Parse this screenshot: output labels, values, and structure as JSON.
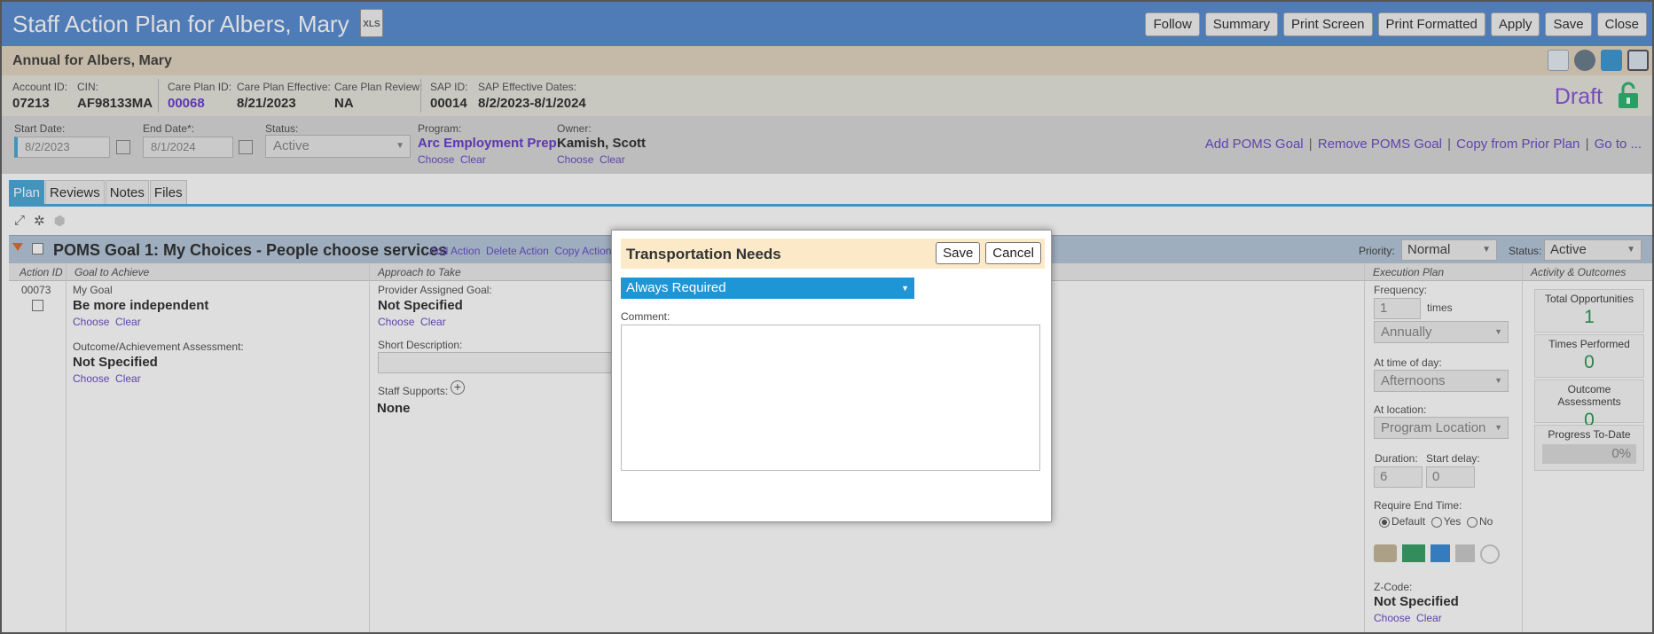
{
  "window": {
    "title": "Staff Action Plan for Albers, Mary",
    "xls_label": "XLS",
    "buttons": [
      "Follow",
      "Summary",
      "Print Screen",
      "Print Formatted",
      "Apply",
      "Save",
      "Close"
    ]
  },
  "annual": {
    "label": "Annual for Albers, Mary"
  },
  "info": {
    "account_id_label": "Account ID:",
    "account_id": "07213",
    "cin_label": "CIN:",
    "cin": "AF98133MA",
    "care_plan_id_label": "Care Plan ID:",
    "care_plan_id": "00068",
    "care_plan_effective_label": "Care Plan Effective:",
    "care_plan_effective": "8/21/2023",
    "care_plan_review_label": "Care Plan Review:",
    "care_plan_review": "NA",
    "sap_id_label": "SAP ID:",
    "sap_id": "00014",
    "sap_dates_label": "SAP Effective Dates:",
    "sap_dates": "8/2/2023-8/1/2024",
    "status_text": "Draft"
  },
  "controls": {
    "start_date_label": "Start Date:",
    "start_date": "8/2/2023",
    "end_date_label": "End Date*:",
    "end_date": "8/1/2024",
    "status_label": "Status:",
    "status": "Active",
    "program_label": "Program:",
    "program": "Arc Employment Prep",
    "owner_label": "Owner:",
    "owner": "Kamish, Scott",
    "choose": "Choose",
    "clear": "Clear",
    "links": [
      "Add POMS Goal",
      "Remove POMS Goal",
      "Copy from Prior Plan",
      "Go to ..."
    ]
  },
  "tabs": [
    "Plan",
    "Reviews",
    "Notes",
    "Files"
  ],
  "goal": {
    "title": "POMS Goal 1: My Choices - People choose services",
    "actions": [
      "Add Action",
      "Delete Action",
      "Copy Action"
    ],
    "priority_label": "Priority:",
    "priority": "Normal",
    "status_label": "Status:",
    "status": "Active"
  },
  "columns": [
    "Action ID",
    "Goal to Achieve",
    "Approach to Take",
    "Execution Plan",
    "Activity & Outcomes"
  ],
  "row": {
    "action_id": "00073",
    "my_goal_label": "My Goal",
    "my_goal": "Be more independent",
    "outcome_label": "Outcome/Achievement Assessment:",
    "outcome": "Not Specified",
    "provider_goal_label": "Provider Assigned Goal:",
    "provider_goal": "Not Specified",
    "short_desc_label": "Short Description:",
    "staff_supports_label": "Staff Supports:",
    "staff_supports": "None",
    "frequency_label": "Frequency:",
    "frequency": "1",
    "times": "times",
    "period": "Annually",
    "time_of_day_label": "At time of day:",
    "time_of_day": "Afternoons",
    "location_label": "At location:",
    "location": "Program Location",
    "duration_label": "Duration:",
    "duration": "6",
    "start_delay_label": "Start delay:",
    "start_delay": "0",
    "require_end_label": "Require End Time:",
    "opt_default": "Default",
    "opt_yes": "Yes",
    "opt_no": "No",
    "zcode_label": "Z-Code:",
    "zcode": "Not Specified"
  },
  "stats": {
    "total_label": "Total Opportunities",
    "total": "1",
    "performed_label": "Times Performed",
    "performed": "0",
    "assess_label": "Outcome Assessments",
    "assess": "0",
    "progress_label": "Progress To-Date",
    "progress": "0%"
  },
  "modal": {
    "title": "Transportation Needs",
    "save": "Save",
    "cancel": "Cancel",
    "selected": "Always Required",
    "comment_label": "Comment:",
    "comment": ""
  },
  "colors": {
    "titlebar": "#5b8fd3",
    "tab_active": "#4fa9d9",
    "dropdown": "#1e96d6",
    "draft": "#8a58d8",
    "lock": "#2eb872"
  }
}
